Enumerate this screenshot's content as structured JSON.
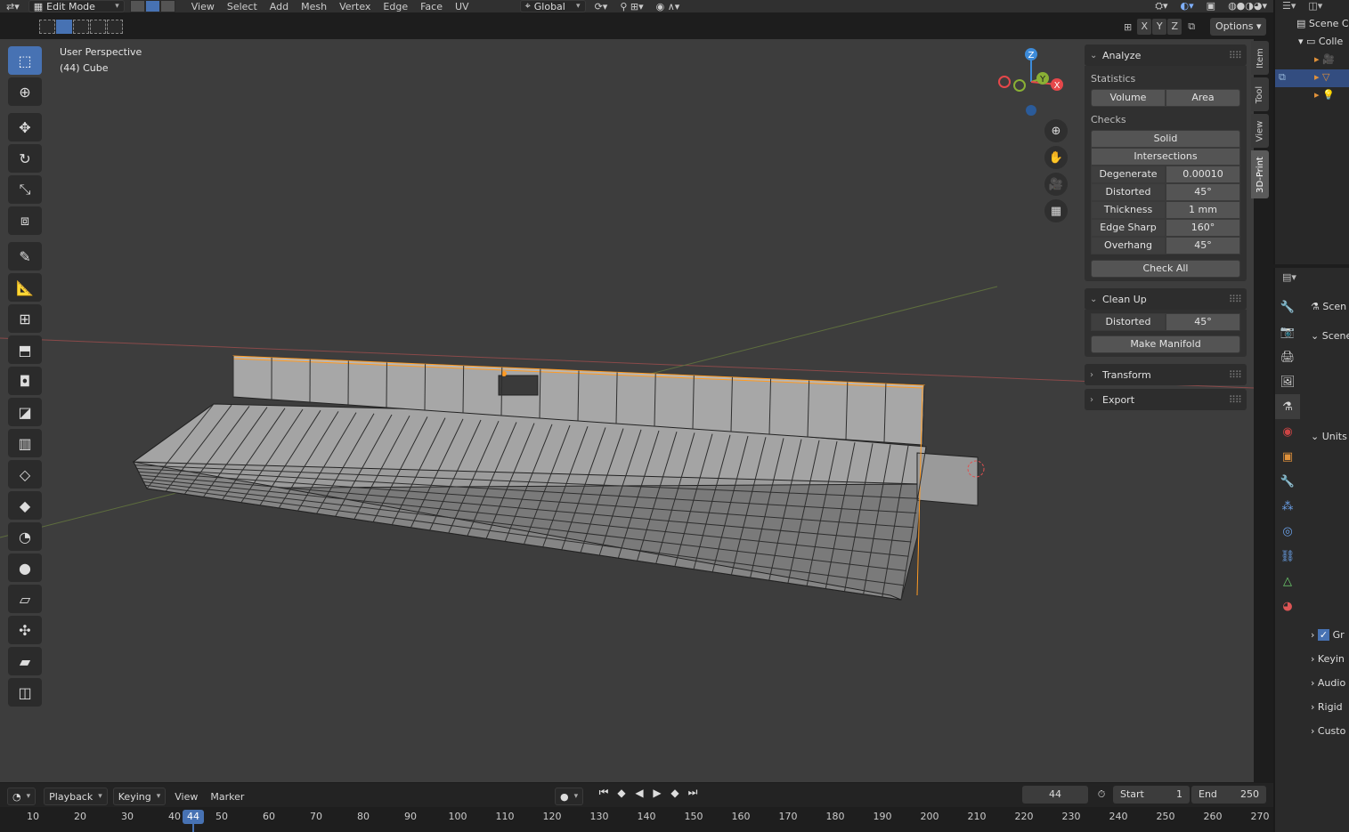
{
  "header": {
    "mode": "Edit Mode",
    "menus": [
      "View",
      "Select",
      "Add",
      "Mesh",
      "Vertex",
      "Edge",
      "Face",
      "UV"
    ],
    "orientation": "Global"
  },
  "toolbar2": {
    "axes": [
      "X",
      "Y",
      "Z"
    ],
    "options": "Options"
  },
  "viewport": {
    "view_name": "User Perspective",
    "object_label": "(44) Cube",
    "gizmo_axes": [
      "Z",
      "Y",
      "X"
    ]
  },
  "npanel": {
    "tabs": [
      "Item",
      "Tool",
      "View",
      "3D-Print"
    ],
    "analyze": {
      "title": "Analyze",
      "statistics_label": "Statistics",
      "volume": "Volume",
      "area": "Area",
      "checks_label": "Checks",
      "solid": "Solid",
      "intersections": "Intersections",
      "rows": [
        {
          "label": "Degenerate",
          "value": "0.00010"
        },
        {
          "label": "Distorted",
          "value": "45°"
        },
        {
          "label": "Thickness",
          "value": "1 mm"
        },
        {
          "label": "Edge Sharp",
          "value": "160°"
        },
        {
          "label": "Overhang",
          "value": "45°"
        }
      ],
      "check_all": "Check All"
    },
    "cleanup": {
      "title": "Clean Up",
      "distorted_label": "Distorted",
      "distorted_value": "45°",
      "make_manifold": "Make Manifold"
    },
    "transform": "Transform",
    "export": "Export"
  },
  "outliner": {
    "scene": "Scene C",
    "collection": "Colle"
  },
  "properties": {
    "scene": "Scen",
    "scene_panel": "Scene",
    "units": "Units",
    "subpanels": [
      "Gr",
      "Keyin",
      "Audio",
      "Rigid",
      "Custo"
    ]
  },
  "timeline": {
    "menus": [
      "Playback",
      "Keying",
      "View",
      "Marker"
    ],
    "current_frame": "44",
    "start_label": "Start",
    "start_value": "1",
    "end_label": "End",
    "end_value": "250",
    "ruler": [
      "10",
      "20",
      "30",
      "40",
      "50",
      "60",
      "70",
      "80",
      "90",
      "100",
      "110",
      "120",
      "130",
      "140",
      "150",
      "160",
      "170",
      "180",
      "190",
      "200",
      "210",
      "220",
      "230",
      "240",
      "250",
      "260",
      "270"
    ]
  },
  "colors": {
    "accent": "#4772b3",
    "axis_x": "#e5474a",
    "axis_y": "#8ab035",
    "axis_z": "#3d8bd9",
    "selection": "#ff9b23"
  }
}
